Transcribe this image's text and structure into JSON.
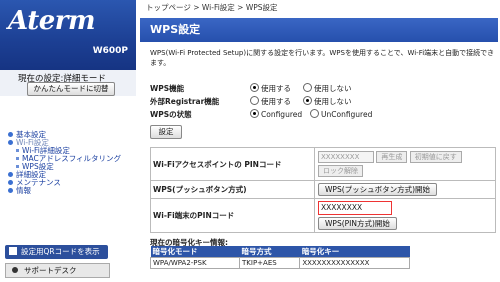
{
  "app": {
    "logo": "Aterm",
    "model": "W600P"
  },
  "mode": {
    "current": "現在の設定:詳細モード",
    "switch_label": "かんたんモードに切替"
  },
  "menu": {
    "basic": "基本設定",
    "wifi": "Wi-Fi設定",
    "wifi_detail": "Wi-Fi詳細設定",
    "mac_filter": "MACアドレスフィルタリング",
    "wps": "WPS設定",
    "detail": "詳細設定",
    "maintenance": "メンテナンス",
    "info": "情報"
  },
  "qr_button": "設定用QRコードを表示",
  "support_button": "サポートデスク",
  "breadcrumb": "トップページ > Wi-Fi設定 > WPS設定",
  "page_title": "WPS設定",
  "description": "WPS(Wi-Fi Protected Setup)に関する設定を行います。WPSを使用することで、Wi-Fi端末と自動で接続できます。",
  "settings": {
    "wps_func": {
      "label": "WPS機能",
      "opt1": "使用する",
      "opt2": "使用しない"
    },
    "ext_reg": {
      "label": "外部Registrar機能",
      "opt1": "使用する",
      "opt2": "使用しない"
    },
    "wps_state": {
      "label": "WPSの状態",
      "opt1": "Configured",
      "opt2": "UnConfigured"
    }
  },
  "set_button": "設定",
  "table": {
    "ap_pin_label": "Wi-Fiアクセスポイントの PINコード",
    "ap_pin_value": "XXXXXXXX",
    "regen_button": "再生成",
    "reset_button": "初期値に戻す",
    "unlock_button": "ロック解除",
    "push_label": "WPS(プッシュボタン方式)",
    "push_button": "WPS(プッシュボタン方式)開始",
    "client_pin_label": "Wi-Fi端末のPINコード",
    "client_pin_value": "XXXXXXXX",
    "pin_button": "WPS(PIN方式)開始"
  },
  "encryption": {
    "title": "現在の暗号化キー情報:",
    "headers": [
      "暗号化モード",
      "暗号方式",
      "暗号化キー"
    ],
    "row": [
      "WPA/WPA2-PSK",
      "TKIP+AES",
      "XXXXXXXXXXXXXX"
    ]
  },
  "colors": {
    "brand_blue": "#2650ad",
    "highlight_red": "#e33"
  }
}
